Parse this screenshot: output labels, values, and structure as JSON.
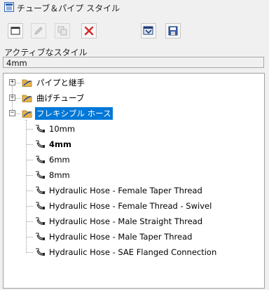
{
  "window": {
    "title": "チューブ＆パイプ スタイル"
  },
  "active_style": {
    "label": "アクティブなスタイル",
    "value": "4mm"
  },
  "tree": {
    "categories": [
      {
        "label": "パイプと継手",
        "expander": "+",
        "selected": false
      },
      {
        "label": "曲げチューブ",
        "expander": "+",
        "selected": false
      },
      {
        "label": "フレキシブル ホース",
        "expander": "−",
        "selected": true
      }
    ],
    "children": [
      {
        "label": "10mm",
        "bold": false
      },
      {
        "label": "4mm",
        "bold": true
      },
      {
        "label": "6mm",
        "bold": false
      },
      {
        "label": "8mm",
        "bold": false
      },
      {
        "label": "Hydraulic Hose - Female Taper Thread",
        "bold": false
      },
      {
        "label": "Hydraulic Hose - Female Thread - Swivel",
        "bold": false
      },
      {
        "label": "Hydraulic Hose - Male Straight Thread",
        "bold": false
      },
      {
        "label": "Hydraulic Hose - Male Taper Thread",
        "bold": false
      },
      {
        "label": "Hydraulic Hose - SAE Flanged Connection",
        "bold": false
      }
    ]
  },
  "colors": {
    "selection": "#0078d7",
    "delete_red": "#d42b2b",
    "folder": "#e8b34a"
  }
}
